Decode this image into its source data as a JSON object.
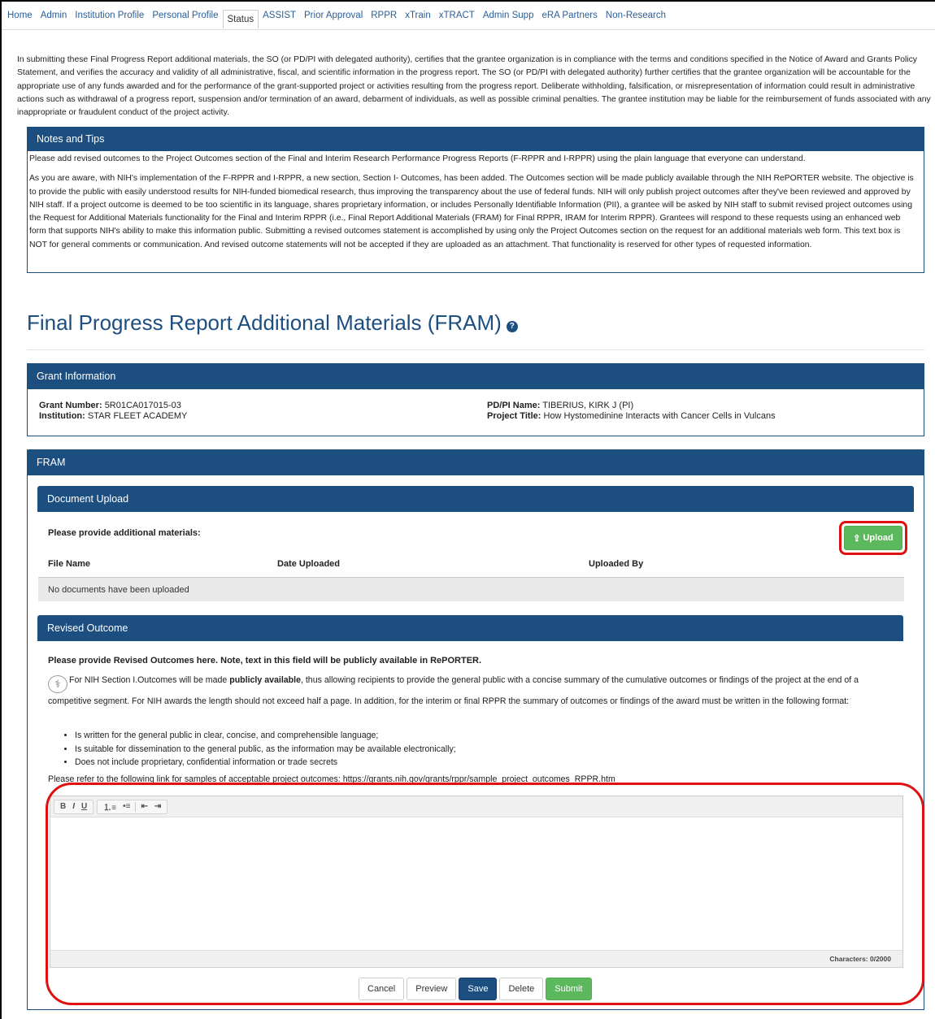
{
  "nav": {
    "items": [
      "Home",
      "Admin",
      "Institution Profile",
      "Personal Profile",
      "Status",
      "ASSIST",
      "Prior Approval",
      "RPPR",
      "xTrain",
      "xTRACT",
      "Admin Supp",
      "eRA Partners",
      "Non-Research"
    ],
    "active": "Status"
  },
  "certification_text": "In submitting these Final Progress Report additional materials, the SO (or PD/PI with delegated authority), certifies that the grantee organization is in compliance with the terms and conditions specified in the Notice of Award and Grants Policy Statement, and verifies the accuracy and validity of all administrative, fiscal, and scientific information in the progress report. The SO (or PD/PI with delegated authority) further certifies that the grantee organization will be accountable for the appropriate use of any funds awarded and for the performance of the grant-supported project or activities resulting from the progress report. Deliberate withholding, falsification, or misrepresentation of information could result in administrative actions such as withdrawal of a progress report, suspension and/or termination of an award, debarment of individuals, as well as possible criminal penalties. The grantee institution may be liable for the reimbursement of funds associated with any inappropriate or fraudulent conduct of the project activity.",
  "notes": {
    "title": "Notes and Tips",
    "p1": "Please add revised outcomes to the Project Outcomes section of the Final and Interim Research Performance Progress Reports (F-RPPR and I-RPPR) using the plain language that everyone can understand.",
    "p2": "As you are aware, with NIH's implementation of the F-RPPR and I-RPPR, a new section, Section I- Outcomes, has been added. The Outcomes section will be made publicly available through the NIH RePORTER website. The objective is to provide the public with easily understood results for NIH-funded biomedical research, thus improving the transparency about the use of federal funds. NIH will only publish project outcomes after they've been reviewed and approved by NIH staff. If a project outcome is deemed to be too scientific in its language, shares proprietary information, or includes Personally Identifiable Information (PII), a grantee will be asked by NIH staff to submit revised project outcomes using the Request for Additional Materials functionality for the Final and Interim RPPR (i.e., Final Report Additional Materials (FRAM) for Final RPPR, IRAM for Interim RPPR). Grantees will respond to these requests using an enhanced web form that supports NIH's ability to make this information public. Submitting a revised outcomes statement is accomplished by using only the Project Outcomes section on the request for an additional materials web form. This text box is NOT for general comments or communication. And revised outcome statements will not be accepted if they are uploaded as an attachment. That functionality is reserved for other types of requested information."
  },
  "page_title": "Final Progress Report Additional Materials (FRAM)",
  "grant": {
    "title": "Grant Information",
    "grant_number_label": "Grant Number:",
    "grant_number": "5R01CA017015-03",
    "institution_label": "Institution:",
    "institution": "STAR FLEET ACADEMY",
    "pdpi_label": "PD/PI Name:",
    "pdpi": "TIBERIUS, KIRK J (PI)",
    "project_title_label": "Project Title:",
    "project_title": "How Hystomedinine Interacts with Cancer Cells in Vulcans"
  },
  "fram": {
    "title": "FRAM",
    "doc_upload_title": "Document Upload",
    "provide_label": "Please provide additional materials:",
    "upload_button": "Upload",
    "columns": [
      "File Name",
      "Date Uploaded",
      "Uploaded By"
    ],
    "empty_message": "No documents have been uploaded",
    "revised_title": "Revised Outcome",
    "revised_instruction": "Please provide Revised Outcomes here. Note, text in this field will be publicly available in RePORTER.",
    "revised_para_pre": "For NIH Section I.Outcomes will be made ",
    "revised_para_bold": "publicly available",
    "revised_para_post": ", thus allowing recipients to provide the general public with a concise summary of the cumulative outcomes or findings of the project at the end of a competitive segment. For NIH awards the length should not exceed half a page. In addition, for the interim or final RPPR the summary of outcomes or findings of the award must be written in the following format:",
    "bullets": [
      "Is written for the general public in clear, concise, and comprehensible language;",
      "Is suitable for dissemination to the general public, as the information may be available electronically;",
      "Does not include proprietary, confidential information or trade secrets"
    ],
    "link_text": "Please refer to the following link for samples of acceptable project outcomes: https://grants.nih.gov/grants/rppr/sample_project_outcomes_RPPR.htm",
    "toolbar": {
      "bold": "B",
      "italic": "I",
      "underline": "U"
    },
    "char_count": "Characters: 0/2000",
    "buttons": {
      "cancel": "Cancel",
      "preview": "Preview",
      "save": "Save",
      "delete": "Delete",
      "submit": "Submit"
    }
  },
  "colors": {
    "panel_header": "#1c4e80",
    "success": "#5cb85c",
    "highlight": "#e01010",
    "link": "#2a5e96"
  }
}
